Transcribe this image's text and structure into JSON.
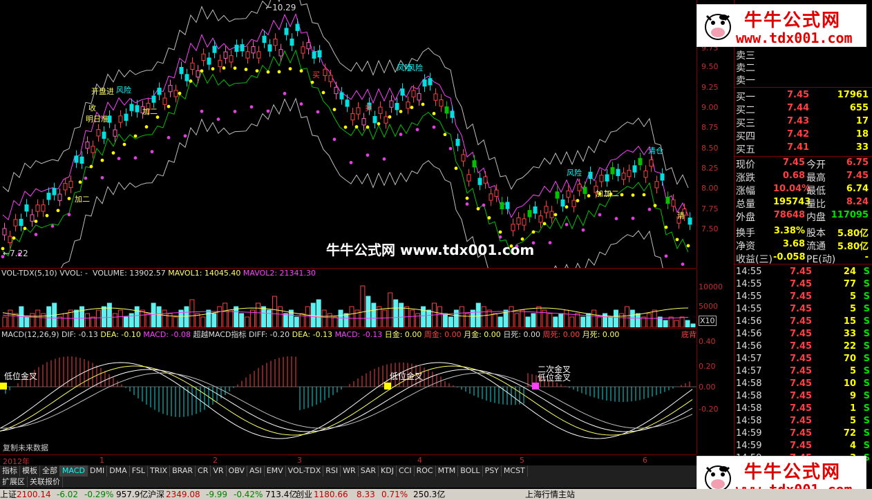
{
  "main_chart": {
    "price_ticks": [
      "9.75",
      "9.50",
      "9.25",
      "9.00",
      "8.75",
      "8.50",
      "8.25",
      "8.00",
      "7.75",
      "7.50"
    ],
    "annotations": {
      "high": "10.29",
      "low": "7.22",
      "labels": [
        "明日准",
        "收",
        "开盘进",
        "风险",
        "加二",
        "加二",
        "风险",
        "买",
        "卖",
        "风险",
        "加二",
        "清仓",
        "风险",
        "加二",
        "清"
      ],
      "center_watermark": "牛牛公式网 www.tdx001.com"
    }
  },
  "volume_panel": {
    "header": {
      "name": "VOL-TDX(5,10)",
      "vvol": "VVOL: -",
      "volume": "VOLUME: 13902.57",
      "mavol1": "MAVOL1: 14045.40",
      "mavol2": "MAVOL2: 21341.30"
    },
    "ticks": [
      "10000",
      "5000"
    ],
    "unit": "X10",
    "bars": [
      3,
      5,
      4,
      6,
      3,
      4,
      5,
      4,
      6,
      7,
      3,
      4,
      5,
      5,
      6,
      4,
      3,
      5,
      6,
      7,
      4,
      5,
      3,
      4,
      6,
      5,
      4,
      7,
      6,
      5,
      4,
      3,
      5,
      6,
      8,
      4,
      3,
      5,
      4,
      6,
      7,
      5,
      6,
      4,
      3,
      5,
      7,
      6,
      5,
      9,
      6,
      4,
      5,
      3,
      4,
      6,
      7,
      8,
      5,
      4,
      3,
      5,
      4,
      6,
      5,
      12,
      9,
      7,
      6,
      5,
      10,
      8,
      7,
      6,
      5,
      4,
      6,
      5,
      7,
      6,
      4,
      3,
      5,
      6,
      4,
      5,
      7,
      6,
      5,
      4,
      3,
      5,
      6,
      4,
      5,
      3,
      4,
      6,
      5,
      4,
      3,
      4,
      5,
      3,
      4,
      3,
      4,
      5,
      3,
      4,
      3,
      5,
      4,
      6,
      5,
      4,
      3,
      4,
      5,
      3,
      2,
      3,
      2,
      3,
      2,
      1
    ]
  },
  "macd_panel": {
    "header": {
      "name": "MACD(12,26,9)",
      "dif": "DIF: -0.13",
      "dea": "DEA: -0.10",
      "macd": "MACD: -0.08",
      "super": "超越MACD指标",
      "diff2": "DIFF: -0.20",
      "dea2": "DEA: -0.13",
      "macd2": "MACD: -0.13",
      "day_gold": "日金: 0.00",
      "week_gold": "周金: 0.00",
      "month_gold": "月金: 0.00",
      "day_dead": "日死: 0.00",
      "week_dead": "周死: 0.00",
      "month_dead": "月死: 0.00",
      "bottom": "底背"
    },
    "ticks": [
      "0.40",
      "0.20",
      "0.00",
      "-0.20"
    ],
    "labels": [
      "低位金叉",
      "低位金叉",
      "二次金叉",
      "低位金叉"
    ],
    "footer": "复制未来数据"
  },
  "time_axis": {
    "labels": [
      "2012年",
      "1",
      "2",
      "3",
      "4",
      "5",
      "6"
    ]
  },
  "tabs": {
    "primary": [
      "指标",
      "模板",
      "全部",
      "MACD",
      "DMI",
      "DMA",
      "FSL",
      "TRIX",
      "BRAR",
      "CR",
      "VR",
      "OBV",
      "ASI",
      "EMV",
      "VOL-TDX",
      "RSI",
      "WR",
      "SAR",
      "KDJ",
      "CCI",
      "ROC",
      "MTM",
      "BOLL",
      "PSY",
      "MCST"
    ],
    "active": "MACD",
    "secondary": [
      "扩展区",
      "关联报价"
    ]
  },
  "quote_panel": {
    "sell": [
      "卖三",
      "卖二",
      "卖一"
    ],
    "buy": [
      {
        "label": "买一",
        "price": "7.45",
        "vol": "17961"
      },
      {
        "label": "买二",
        "price": "7.44",
        "vol": "655"
      },
      {
        "label": "买三",
        "price": "7.43",
        "vol": "17"
      },
      {
        "label": "买四",
        "price": "7.42",
        "vol": "18"
      },
      {
        "label": "买五",
        "price": "7.41",
        "vol": "33"
      }
    ],
    "stats": [
      {
        "l1": "现价",
        "v1": "7.45",
        "l2": "今开",
        "v2": "6.75",
        "c1": "#ff4040",
        "c2": "#ff4040"
      },
      {
        "l1": "涨跌",
        "v1": "0.68",
        "l2": "最高",
        "v2": "7.45",
        "c1": "#ff4040",
        "c2": "#ff4040"
      },
      {
        "l1": "涨幅",
        "v1": "10.04%",
        "l2": "最低",
        "v2": "6.74",
        "c1": "#ff4040",
        "c2": "#ffff00"
      },
      {
        "l1": "总量",
        "v1": "195743",
        "l2": "量比",
        "v2": "8.24",
        "c1": "#ffff00",
        "c2": "#ff4040"
      },
      {
        "l1": "外盘",
        "v1": "78648",
        "l2": "内盘",
        "v2": "117095",
        "c1": "#ff4040",
        "c2": "#00e000"
      },
      {
        "l1": "换手",
        "v1": "3.38%",
        "l2": "股本",
        "v2": "5.80亿",
        "c1": "#ffff00",
        "c2": "#ffff00"
      },
      {
        "l1": "净资",
        "v1": "3.68",
        "l2": "流通",
        "v2": "5.80亿",
        "c1": "#ffff00",
        "c2": "#ffff00"
      },
      {
        "l1": "收益(三)",
        "v1": "-0.058",
        "l2": "PE(动)",
        "v2": "-",
        "c1": "#ffff00",
        "c2": "#ffff00"
      }
    ],
    "ticks": [
      {
        "t": "14:55",
        "p": "7.45",
        "v": "24",
        "s": "S"
      },
      {
        "t": "14:55",
        "p": "7.45",
        "v": "77",
        "s": "S"
      },
      {
        "t": "14:55",
        "p": "7.45",
        "v": "5",
        "s": "S"
      },
      {
        "t": "14:55",
        "p": "7.45",
        "v": "5",
        "s": "S"
      },
      {
        "t": "14:56",
        "p": "7.45",
        "v": "15",
        "s": "S"
      },
      {
        "t": "14:56",
        "p": "7.45",
        "v": "33",
        "s": "S"
      },
      {
        "t": "14:56",
        "p": "7.45",
        "v": "22",
        "s": "S"
      },
      {
        "t": "14:57",
        "p": "7.45",
        "v": "70",
        "s": "S"
      },
      {
        "t": "14:57",
        "p": "7.45",
        "v": "5",
        "s": "S"
      },
      {
        "t": "14:58",
        "p": "7.45",
        "v": "10",
        "s": "S"
      },
      {
        "t": "14:58",
        "p": "7.45",
        "v": "9",
        "s": "S"
      },
      {
        "t": "14:58",
        "p": "7.45",
        "v": "1",
        "s": "S"
      },
      {
        "t": "14:58",
        "p": "7.45",
        "v": "5",
        "s": "S"
      },
      {
        "t": "14:59",
        "p": "7.45",
        "v": "72",
        "s": "S"
      },
      {
        "t": "14:59",
        "p": "7.45",
        "v": "4",
        "s": "S"
      },
      {
        "t": "14:59",
        "p": "7.45",
        "v": "3",
        "s": "S"
      }
    ]
  },
  "status_bar": {
    "sh_label": "上证",
    "sh_value": "2100.14",
    "sh_change": "-6.02",
    "sh_pct": "-0.29%",
    "sh_amount": "957.9亿",
    "hs_label": "沪深",
    "hs_value": "2349.08",
    "hs_change": "-9.99",
    "hs_pct": "-0.42%",
    "hs_amount": "713.4亿",
    "cy_label": "创业",
    "cy_value": "1180.66",
    "cy_change": "8.33",
    "cy_pct": "0.71%",
    "cy_amount": "250.3亿",
    "site": "上海行情主站"
  },
  "watermark": {
    "brand": "牛牛公式网",
    "url": "www.tdx001.com"
  }
}
